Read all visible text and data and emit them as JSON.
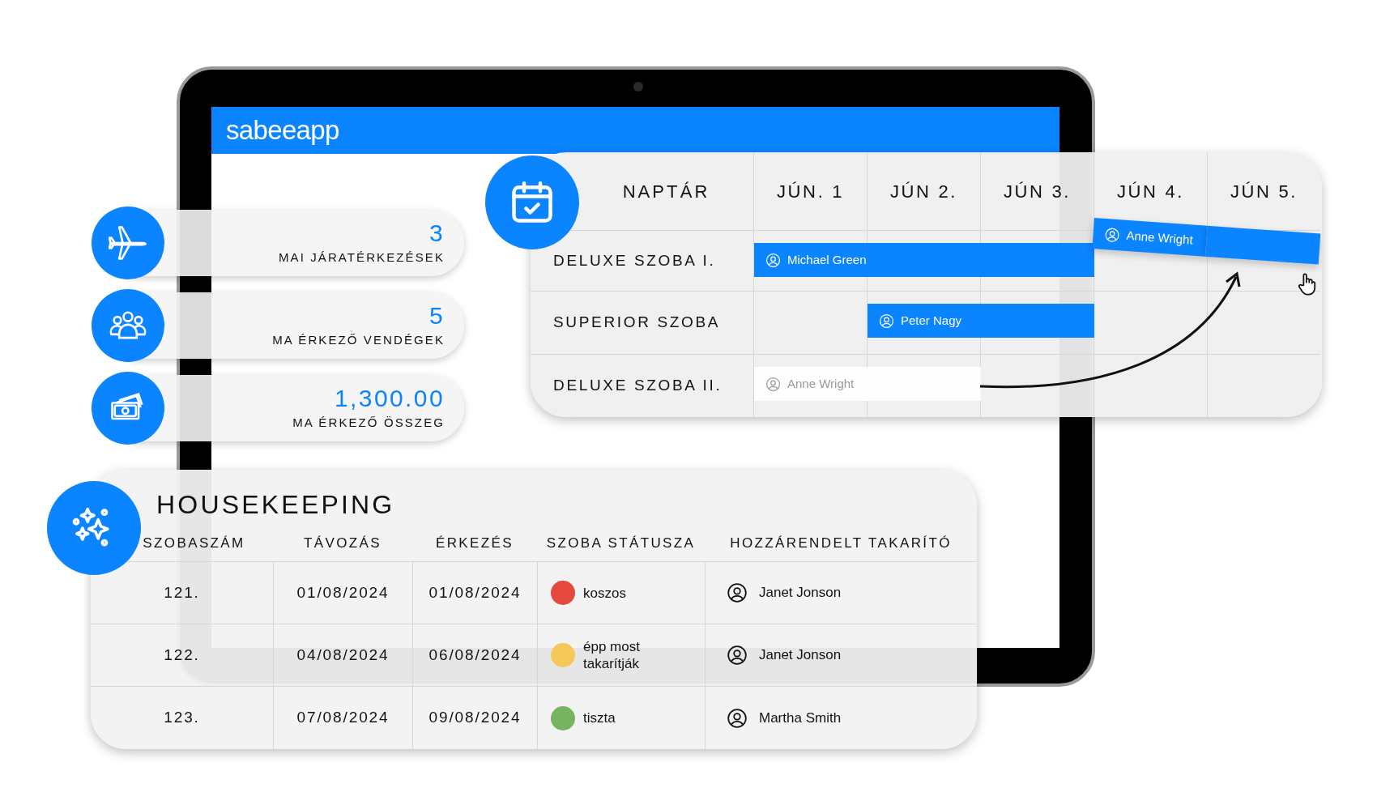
{
  "app": {
    "logo": "sabeeapp"
  },
  "stats": [
    {
      "kind": "plane",
      "value": "3",
      "label": "MAI JÁRATÉRKEZÉSEK"
    },
    {
      "kind": "guests",
      "value": "5",
      "label": "MA ÉRKEZŐ VENDÉGEK"
    },
    {
      "kind": "money",
      "value": "1,300.00",
      "label": "MA ÉRKEZŐ ÖSSZEG"
    }
  ],
  "calendar": {
    "title": "NAPTÁR",
    "days": [
      "JÚN. 1",
      "JÚN 2.",
      "JÚN 3.",
      "JÚN 4.",
      "JÚN 5."
    ],
    "rooms": [
      {
        "name": "DELUXE SZOBA I.",
        "bookings": [
          {
            "guest": "Michael Green",
            "kind": "booked",
            "days": [
              true,
              true,
              true,
              false,
              false
            ]
          },
          {
            "guest": "Anne Wright",
            "kind": "dragging",
            "days": [
              false,
              false,
              false,
              true,
              true
            ]
          }
        ]
      },
      {
        "name": "SUPERIOR SZOBA",
        "bookings": [
          {
            "guest": "Peter Nagy",
            "kind": "booked",
            "days": [
              false,
              true,
              true,
              false,
              false
            ]
          }
        ]
      },
      {
        "name": "DELUXE SZOBA II.",
        "bookings": [
          {
            "guest": "Anne Wright",
            "kind": "ghost",
            "days": [
              true,
              true,
              false,
              false,
              false
            ]
          }
        ]
      }
    ]
  },
  "housekeeping": {
    "title": "HOUSEKEEPING",
    "columns": [
      "SZOBASZÁM",
      "TÁVOZÁS",
      "ÉRKEZÉS",
      "SZOBA STÁTUSZA",
      "HOZZÁRENDELT TAKARÍTÓ"
    ],
    "rows": [
      {
        "room": "121.",
        "departure": "01/08/2024",
        "arrival": "01/08/2024",
        "status": "koszos",
        "color": "#e5483f",
        "cleaner": "Janet Jonson"
      },
      {
        "room": "122.",
        "departure": "04/08/2024",
        "arrival": "06/08/2024",
        "status": "épp most takarítják",
        "color": "#f5c85a",
        "cleaner": "Janet Jonson"
      },
      {
        "room": "123.",
        "departure": "07/08/2024",
        "arrival": "09/08/2024",
        "status": "tiszta",
        "color": "#76b461",
        "cleaner": "Martha Smith"
      }
    ]
  }
}
